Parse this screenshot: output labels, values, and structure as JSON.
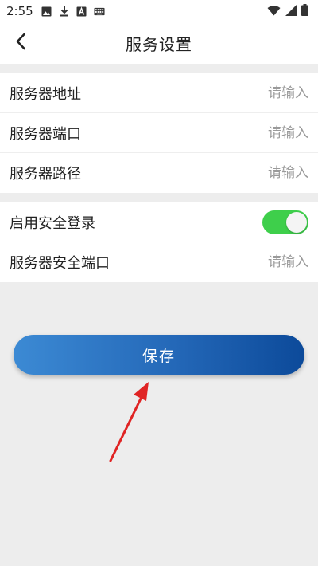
{
  "status_bar": {
    "time": "2:55",
    "left_icons": [
      "image-icon",
      "download-icon",
      "a-icon",
      "keyboard-icon"
    ],
    "right_icons": [
      "wifi-icon",
      "signal-icon",
      "battery-icon"
    ]
  },
  "header": {
    "title": "服务设置",
    "back_icon": "chevron-left-icon"
  },
  "server_section": {
    "items": [
      {
        "label": "服务器地址",
        "placeholder": "请输入"
      },
      {
        "label": "服务器端口",
        "placeholder": "请输入"
      },
      {
        "label": "服务器路径",
        "placeholder": "请输入"
      }
    ]
  },
  "security_section": {
    "secure_login_label": "启用安全登录",
    "secure_login_enabled": true,
    "secure_port_label": "服务器安全端口",
    "secure_port_placeholder": "请输入"
  },
  "actions": {
    "save_label": "保存"
  },
  "colors": {
    "toggle_on": "#3ecf4b",
    "button_gradient_start": "#3c8ad4",
    "button_gradient_end": "#0c4a9a",
    "annotation_arrow": "#e02424",
    "background": "#ededed"
  }
}
